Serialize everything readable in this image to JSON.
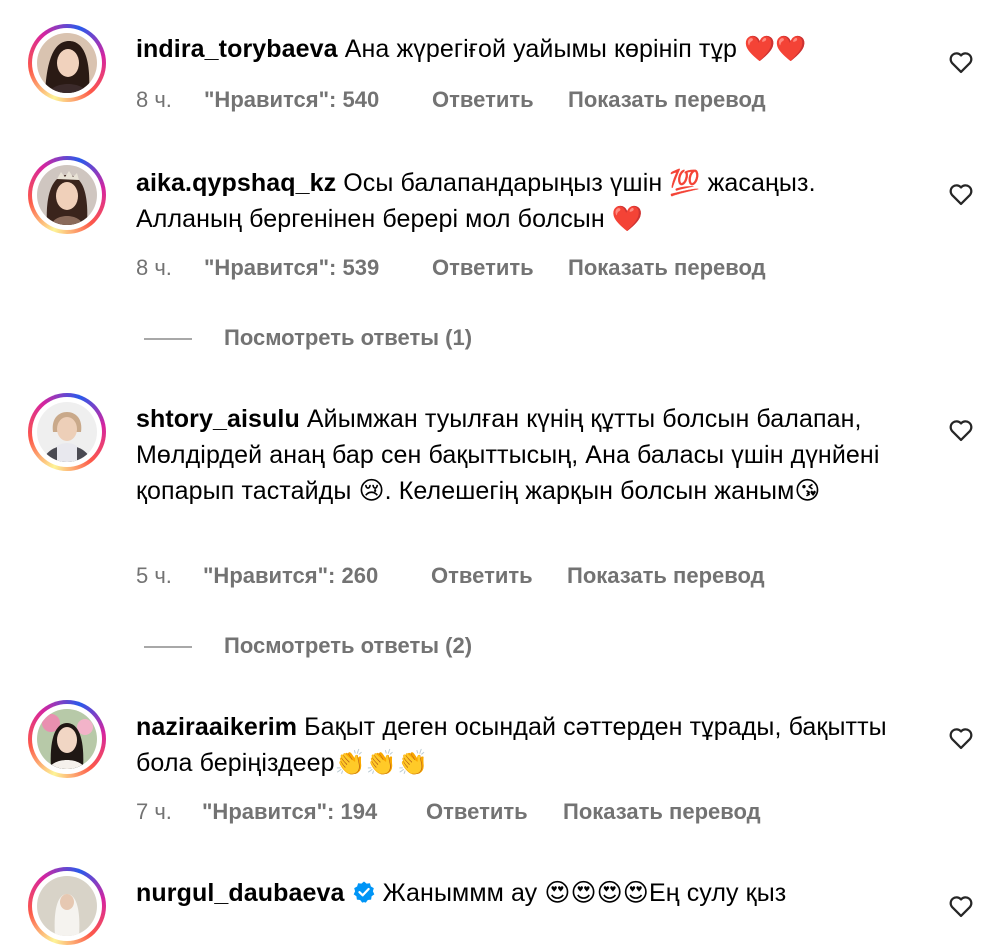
{
  "comments": [
    {
      "username": "indira_torybaeva",
      "text": "Ана жүрегіғой уайымы көрініп тұр ",
      "emoji": "❤️❤️",
      "time": "8 ч.",
      "likes": "\"Нравится\": 540",
      "reply": "Ответить",
      "translate": "Показать перевод"
    },
    {
      "username": "aika.qypshaq_kz",
      "text": "Осы балапандарыңыз үшін 💯 жасаңыз. Алланың бергенінен берері мол болсын ",
      "emoji": "❤️",
      "time": "8 ч.",
      "likes": "\"Нравится\": 539",
      "reply": "Ответить",
      "translate": "Показать перевод",
      "view_replies": "Посмотреть ответы (1)"
    },
    {
      "username": "shtory_aisulu",
      "text": "Айымжан туылған күнің құтты болсын балапан, Мөлдірдей анаң бар сен бақыттысың, Ана баласы үшін дүнйені қопарып тастайды 😢. Келешегің жарқын болсын жаным😘",
      "time": "5 ч.",
      "likes": "\"Нравится\": 260",
      "reply": "Ответить",
      "translate": "Показать перевод",
      "view_replies": "Посмотреть ответы (2)"
    },
    {
      "username": "naziraaikerim",
      "text": "Бақыт деген осындай сәттерден тұрады, бақытты бола беріңіздеер👏👏👏",
      "time": "7 ч.",
      "likes": "\"Нравится\": 194",
      "reply": "Ответить",
      "translate": "Показать перевод"
    },
    {
      "username": "nurgul_daubaeva",
      "text": "Жаныммм ау 😍😍😍😍Ең сулу қыз"
    }
  ],
  "colors": {
    "meta_gray": "#737373",
    "heart_red": "#e2243b",
    "verified_blue": "#0095f6"
  },
  "icons": {
    "like": "heart-outline-icon",
    "verified": "verified-badge-icon"
  }
}
